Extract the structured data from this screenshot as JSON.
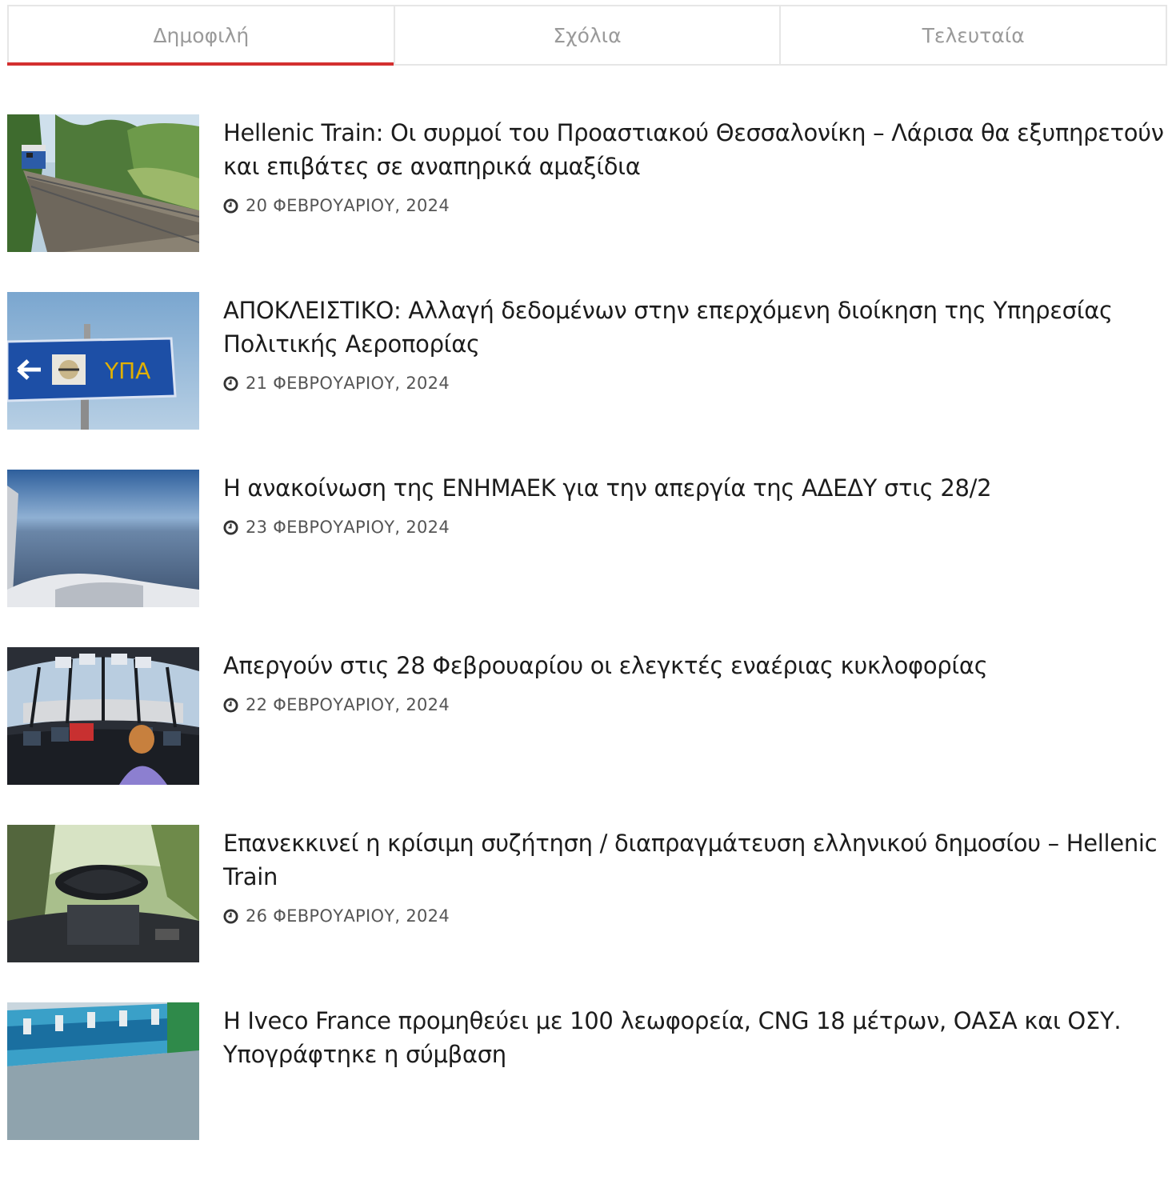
{
  "tabs": [
    {
      "label": "Δημοφιλή",
      "active": true
    },
    {
      "label": "Σχόλια",
      "active": false
    },
    {
      "label": "Τελευταία",
      "active": false
    }
  ],
  "articles": [
    {
      "title": "Hellenic Train: Οι συρμοί του Προαστιακού Θεσσαλονίκη – Λάρισα θα εξυπηρετούν και επιβάτες σε αναπηρικά αμαξίδια",
      "date": "20 ΦΕΒΡΟΥΑΡΙΟΥ, 2024"
    },
    {
      "title": "ΑΠΟΚΛΕΙΣΤΙΚΟ: Αλλαγή δεδομένων στην επερχόμενη διοίκηση της Υπηρεσίας Πολιτικής Αεροπορίας",
      "date": "21 ΦΕΒΡΟΥΑΡΙΟΥ, 2024"
    },
    {
      "title": "Η ανακοίνωση της ΕΝΗΜΑΕΚ για την απεργία της ΑΔΕΔΥ στις 28/2",
      "date": "23 ΦΕΒΡΟΥΑΡΙΟΥ, 2024"
    },
    {
      "title": "Απεργούν στις 28 Φεβρουαρίου οι ελεγκτές εναέριας κυκλοφορίας",
      "date": "22 ΦΕΒΡΟΥΑΡΙΟΥ, 2024"
    },
    {
      "title": "Επανεκκινεί η κρίσιμη συζήτηση / διαπραγμάτευση ελληνικού δημοσίου – Hellenic Train",
      "date": "26 ΦΕΒΡΟΥΑΡΙΟΥ, 2024"
    },
    {
      "title": "Η Iveco France προμηθεύει με 100 λεωφορεία, CNG 18 μέτρων, ΟΑΣΑ και ΟΣΥ. Υπογράφτηκε η σύμβαση",
      "date": ""
    }
  ],
  "sign_text": "ΥΠΑ",
  "icons": {
    "date": "clock-icon"
  },
  "colors": {
    "accent": "#d32f2f",
    "tab_text": "#9a9a9a",
    "title": "#1c1c1c",
    "meta": "#555555"
  }
}
